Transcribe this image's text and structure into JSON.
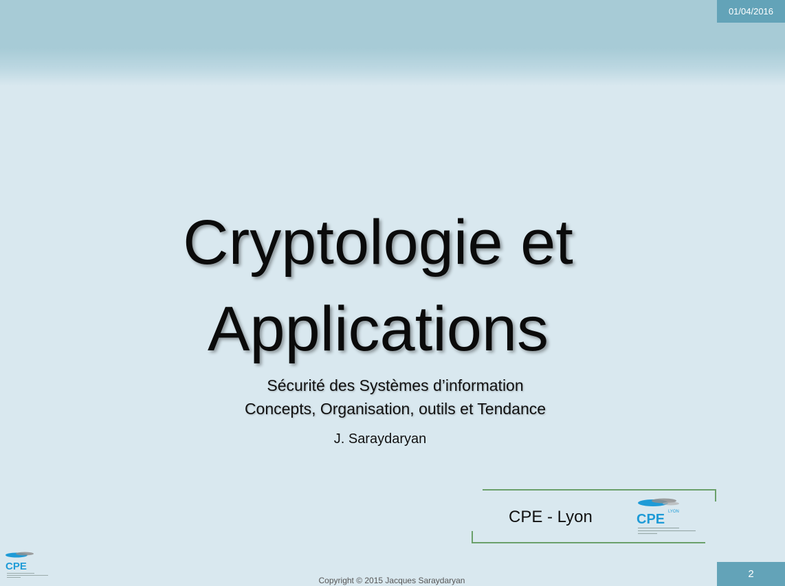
{
  "header": {
    "date": "01/04/2016"
  },
  "slide": {
    "title_line1": "Cryptologie et",
    "title_line2": "Applications",
    "subtitle_line1": "Sécurité des Systèmes d’information",
    "subtitle_line2": "Concepts, Organisation, outils et Tendance",
    "author": "J. Saraydaryan"
  },
  "institution": {
    "label": "CPE - Lyon",
    "logo_text": "CPE",
    "logo_city": "LYON"
  },
  "footer": {
    "copyright": "Copyright © 2015 Jacques Saraydaryan",
    "page_number": "2"
  },
  "colors": {
    "accent": "#63a3b8",
    "band": "#a7cbd6",
    "background": "#d9e8ef",
    "frame_line": "#6aa06a",
    "logo_blue": "#1e9bd7"
  }
}
